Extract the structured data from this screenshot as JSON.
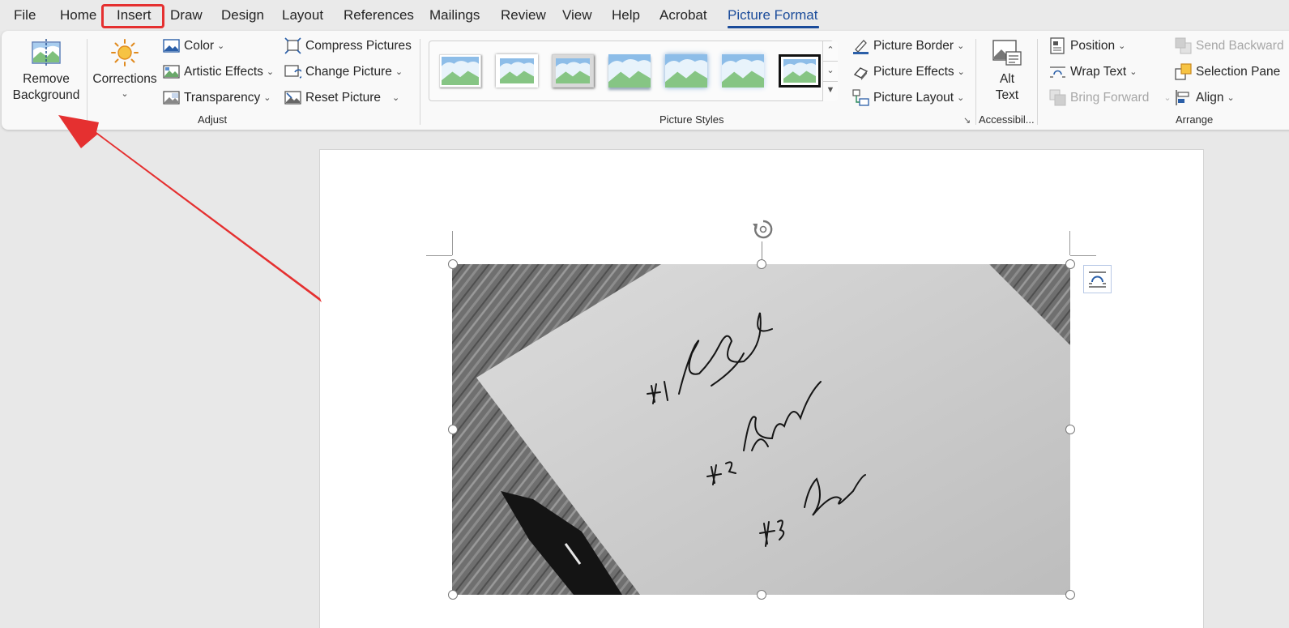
{
  "menu": {
    "tabs": [
      "File",
      "Home",
      "Insert",
      "Draw",
      "Design",
      "Layout",
      "References",
      "Mailings",
      "Review",
      "View",
      "Help",
      "Acrobat",
      "Picture Format"
    ],
    "active_tab": "Picture Format",
    "highlighted_tab": "Insert"
  },
  "ribbon": {
    "remove_background": {
      "line1": "Remove",
      "line2": "Background"
    },
    "corrections": "Corrections",
    "adjust": {
      "color": "Color",
      "artistic_effects": "Artistic Effects",
      "transparency": "Transparency",
      "compress_pictures": "Compress Pictures",
      "change_picture": "Change Picture",
      "reset_picture": "Reset Picture",
      "group_label": "Adjust"
    },
    "picture_styles": {
      "group_label": "Picture Styles",
      "thumb_count": 7,
      "picture_border": "Picture Border",
      "picture_effects": "Picture Effects",
      "picture_layout": "Picture Layout"
    },
    "accessibility": {
      "alt_line1": "Alt",
      "alt_line2": "Text",
      "group_label": "Accessibil..."
    },
    "arrange": {
      "position": "Position",
      "wrap_text": "Wrap Text",
      "bring_forward": "Bring Forward",
      "send_backward": "Send Backward",
      "selection_pane": "Selection Pane",
      "align": "Align",
      "group_label": "Arrange"
    }
  },
  "document": {
    "image_text": [
      "#1",
      "#2",
      "#3"
    ]
  },
  "colors": {
    "accent": "#1a4b9a",
    "annotation_red": "#e53030",
    "ribbon_bg": "#f9f9f9",
    "canvas_bg": "#e8e8e8"
  }
}
